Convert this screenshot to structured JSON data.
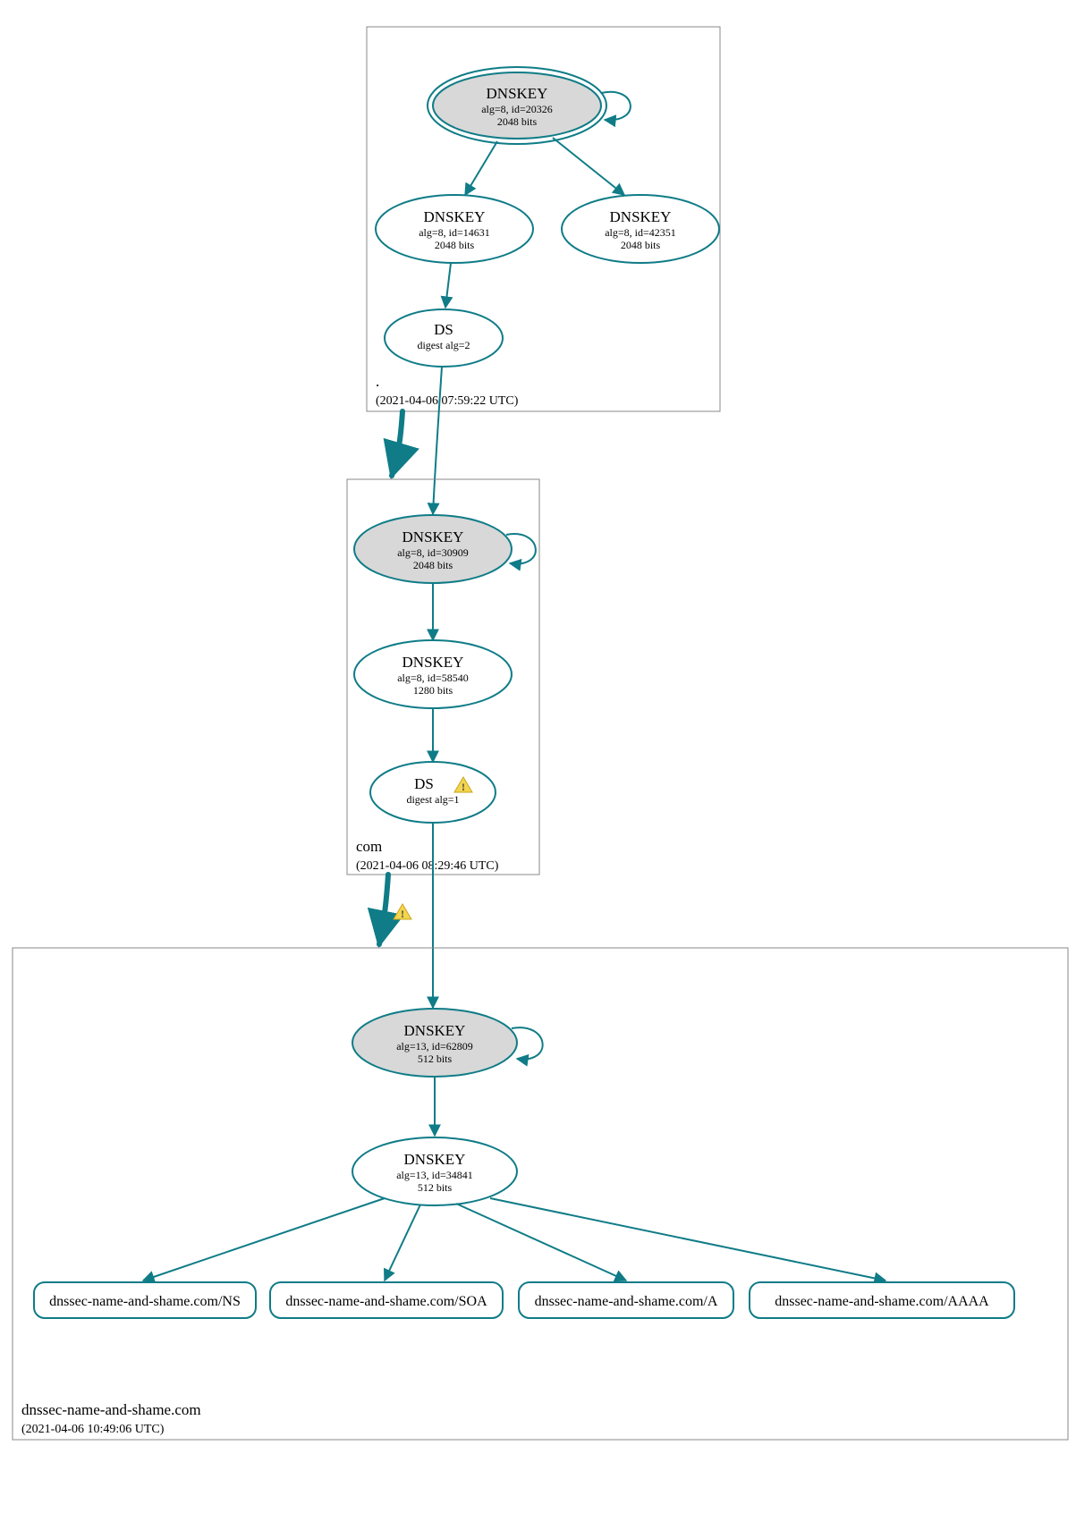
{
  "zones": {
    "root": {
      "name": ".",
      "timestamp": "(2021-04-06 07:59:22 UTC)"
    },
    "com": {
      "name": "com",
      "timestamp": "(2021-04-06 08:29:46 UTC)"
    },
    "leaf": {
      "name": "dnssec-name-and-shame.com",
      "timestamp": "(2021-04-06 10:49:06 UTC)"
    }
  },
  "nodes": {
    "root_ksk": {
      "title": "DNSKEY",
      "line2": "alg=8, id=20326",
      "line3": "2048 bits"
    },
    "root_zsk1": {
      "title": "DNSKEY",
      "line2": "alg=8, id=14631",
      "line3": "2048 bits"
    },
    "root_zsk2": {
      "title": "DNSKEY",
      "line2": "alg=8, id=42351",
      "line3": "2048 bits"
    },
    "root_ds": {
      "title": "DS",
      "line2": "digest alg=2"
    },
    "com_ksk": {
      "title": "DNSKEY",
      "line2": "alg=8, id=30909",
      "line3": "2048 bits"
    },
    "com_zsk": {
      "title": "DNSKEY",
      "line2": "alg=8, id=58540",
      "line3": "1280 bits"
    },
    "com_ds": {
      "title": "DS",
      "line2": "digest alg=1"
    },
    "leaf_ksk": {
      "title": "DNSKEY",
      "line2": "alg=13, id=62809",
      "line3": "512 bits"
    },
    "leaf_zsk": {
      "title": "DNSKEY",
      "line2": "alg=13, id=34841",
      "line3": "512 bits"
    }
  },
  "rrsets": {
    "ns": "dnssec-name-and-shame.com/NS",
    "soa": "dnssec-name-and-shame.com/SOA",
    "a": "dnssec-name-and-shame.com/A",
    "aaaa": "dnssec-name-and-shame.com/AAAA"
  }
}
